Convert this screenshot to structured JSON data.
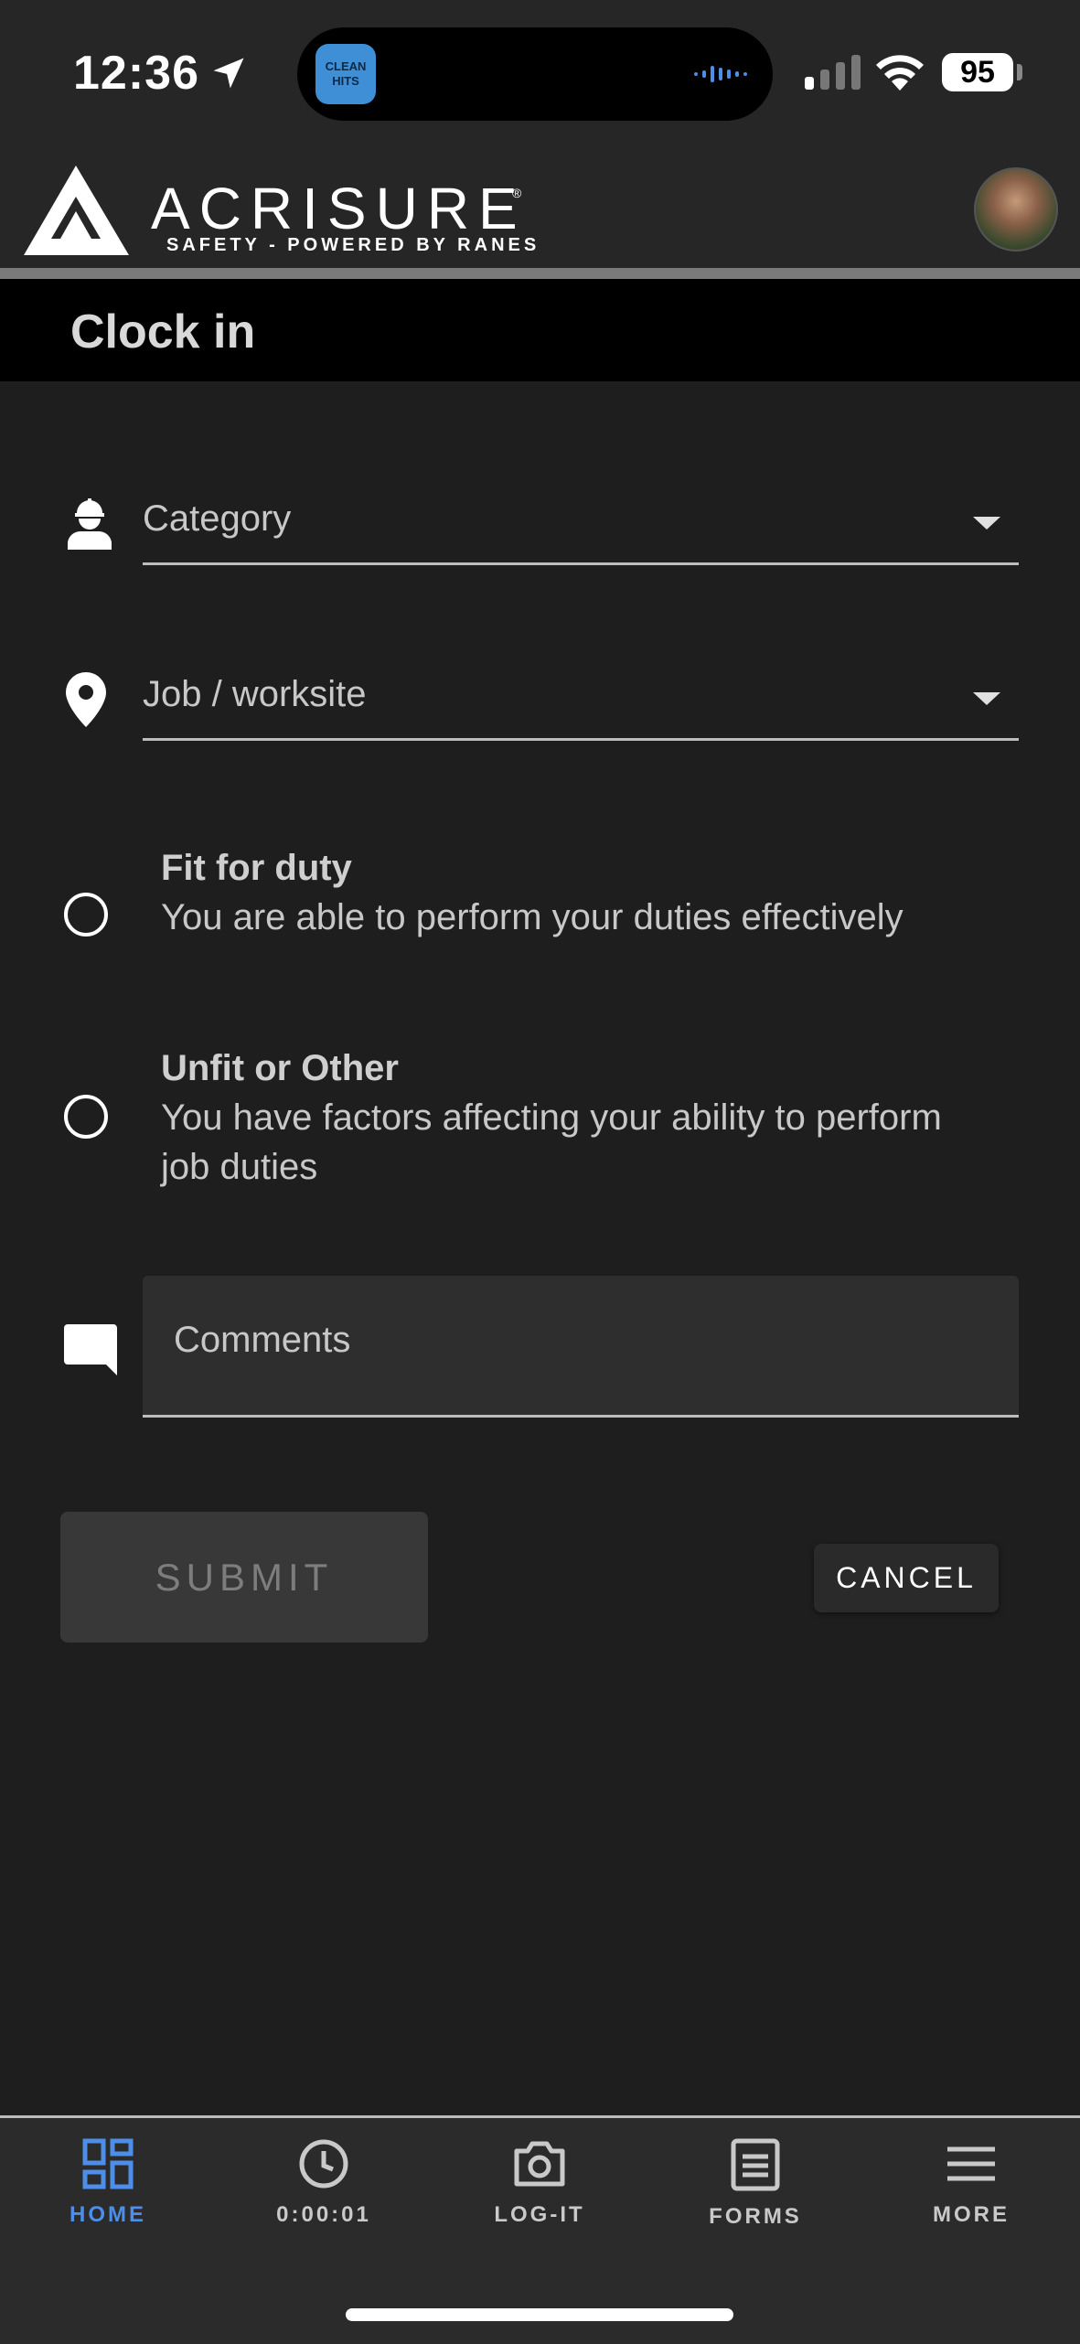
{
  "status_bar": {
    "time": "12:36",
    "island_app_label": "CLEAN HITS",
    "battery": "95"
  },
  "header": {
    "brand_name": "ACRISURE",
    "brand_reg": "®",
    "brand_tagline": "SAFETY - POWERED BY RANES",
    "accent_color": "#4d8ee8"
  },
  "page": {
    "title": "Clock in"
  },
  "form": {
    "category_label": "Category",
    "job_label": "Job / worksite",
    "options": [
      {
        "title": "Fit for duty",
        "description": "You are able to perform your duties effectively"
      },
      {
        "title": "Unfit or Other",
        "description": "You have factors affecting your ability to perform job duties"
      }
    ],
    "comments_placeholder": "Comments",
    "submit_label": "SUBMIT",
    "cancel_label": "CANCEL"
  },
  "nav": {
    "items": [
      {
        "label": "HOME",
        "icon": "dashboard-icon",
        "active": true
      },
      {
        "label": "0:00:01",
        "icon": "clock-icon"
      },
      {
        "label": "LOG-IT",
        "icon": "camera-icon"
      },
      {
        "label": "FORMS",
        "icon": "forms-icon"
      },
      {
        "label": "MORE",
        "icon": "menu-icon"
      }
    ]
  }
}
